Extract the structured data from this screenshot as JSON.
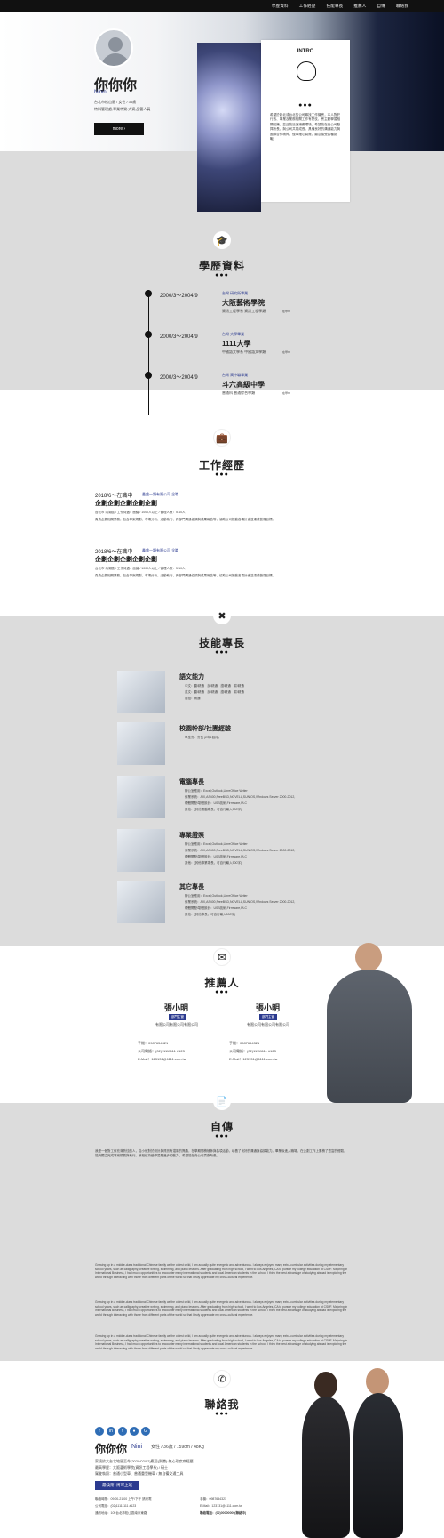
{
  "nav": [
    "學歷資料",
    "工作經歷",
    "技能專長",
    "推薦人",
    "自傳",
    "聯絡我"
  ],
  "profile": {
    "name": "你你你",
    "en": "Ninini",
    "line1": "台北市松山區 / 女性 / 36歲",
    "line2": "特科管理處,專業特質:大資,品管人員",
    "more": "more"
  },
  "intro": {
    "title": "INTRO",
    "body": "希望於新北或台北的公司尋找工作機會，本人對於行政、專業及業務相關工作有熱忱，會主動學習相關知識，並且能迅速適應環境，希望能在貴公司發揮所長，與公司共同成長。具備良好的溝通能力與團隊合作精神，做事細心負責，願意接受各種挑戰。"
  },
  "edu": {
    "title": "學歷資料",
    "items": [
      {
        "date": "2000/3～2004/9",
        "tag": "台灣 研究所畢業",
        "school": "大阪藝術學院",
        "dept": "資訊工程學系 資訊工程學類",
        "note": "在學中"
      },
      {
        "date": "2000/3～2004/9",
        "tag": "台灣 大學畢業",
        "school": "1111大學",
        "dept": "中國語文學系 中國語文學類",
        "note": "在學中"
      },
      {
        "date": "2000/3～2004/9",
        "tag": "台灣 高中職畢業",
        "school": "斗六高級中學",
        "dept": "普通科 普通綜合學類",
        "note": "在學中"
      }
    ]
  },
  "work": {
    "title": "工作經歷",
    "items": [
      {
        "date": "2018/6～在職中",
        "co": "鑫盛一類有限公司 全職",
        "job": "企劃企劃企劃企劃企劃",
        "meta": "台北市 內湖區 / 工作待遇：面議 / 1000人以上 / 管理人數：5-10人",
        "desc": "負責企劃相關業務，包含專案規劃、市場分析、活動執行、跨部門溝通協調與成果報告等，協助公司推動各項計畫並達成營運目標。"
      },
      {
        "date": "2018/6～在職中",
        "co": "鑫盛一類有限公司 全職",
        "job": "企劃企劃企劃企劃企劃",
        "meta": "台北市 內湖區 / 工作待遇：面議 / 1000人以上 / 管理人數：5-10人",
        "desc": "負責企劃相關業務，包含專案規劃、市場分析、活動執行、跨部門溝通協調與成果報告等，協助公司推動各項計畫並達成營運目標。"
      }
    ]
  },
  "skills": {
    "title": "技能專長",
    "items": [
      {
        "name": "語文能力",
        "lines": [
          "中文：聽/精通　說/精通　讀/精通　寫/精通",
          "英文：聽/精通　說/精通　讀/精通　寫/精通",
          "台語：精通"
        ]
      },
      {
        "name": "校園幹部/社團經驗",
        "lines": [
          "學生會：會長 (2年1個月)"
        ]
      },
      {
        "name": "電腦專長",
        "lines": [
          "辦公室應用：Excel,Outlook,LibreOffice Writer",
          "作業系統：AIX,AS400,FreeBSD,NOVELL,SUN OS,Windows Server 2000-2012,",
          "硬體開發/韌體設計：USB技術,Firmware,PLC",
          "其他：(其他電腦專長，可自行輸入500字)"
        ]
      },
      {
        "name": "專業證照",
        "lines": [
          "辦公室應用：Excel,Outlook,LibreOffice Writer",
          "作業系統：AIX,AS400,FreeBSD,NOVELL,SUN OS,Windows Server 2000-2012,",
          "硬體開發/韌體設計：USB技術,Firmware,PLC",
          "其他：(其他專業專長，可自行輸入500字)"
        ]
      },
      {
        "name": "其它專長",
        "lines": [
          "辦公室應用：Excel,Outlook,LibreOffice Writer",
          "作業系統：AIX,AS400,FreeBSD,NOVELL,SUN OS,Windows Server 2000-2012,",
          "硬體開發/韌體設計：USB技術,Firmware,PLC",
          "其他：(其他專長，可自行輸入500字)"
        ]
      }
    ]
  },
  "ref": {
    "title": "推薦人",
    "items": [
      {
        "name": "張小明",
        "tag": "部門主管",
        "co": "有限公司有限公司有限公司",
        "phone": "手機：0987654321",
        "tel": "公司電話：(02)11111111 #123",
        "mail": "E-Mail：123131@1111.com.tw"
      },
      {
        "name": "張小明",
        "tag": "部門主管",
        "co": "有限公司有限公司有限公司",
        "phone": "手機：0987654321",
        "tel": "公司電話：(02)11111111 #123",
        "mail": "E-Mail：123131@1111.com.tw"
      }
    ]
  },
  "bio": {
    "title": "自傳",
    "zh": "我是一個對工作充滿熱忱的人，從小就對於設計與資訊有濃厚的興趣，在學期間積極參與各項活動，培養了良好的溝通與協調能力。畢業後進入職場，在企劃工作上累積了豐富的經驗，能夠獨立完成專案規劃與執行。我相信持續學習是進步的動力，希望能在貴公司貢獻所長。",
    "en1": "Growing up in a middle-class traditional Chinese family as the oldest child, I am actually quite energetic and adventurous. I always enjoyed many extra-curricular activities during my elementary school years, such as calligraphy, creative writing, swimming, and piano lessons. After graduating from high school, I went to Los Angeles, CA to pursue my college education at CSUF. Majoring in International Business, I had much opportunities to encounter many international students and local American students in the school. I think the best advantage of studying abroad is exploring the world through interacting with those from different parts of the world so that I truly appreciate my cross-cultural experience.",
    "en2": "Growing up in a middle-class traditional Chinese family as the oldest child, I am actually quite energetic and adventurous. I always enjoyed many extra-curricular activities during my elementary school years, such as calligraphy, creative writing, swimming, and piano lessons. After graduating from high school, I went to Los Angeles, CA to pursue my college education at CSUF. Majoring in International Business, I had much opportunities to encounter many international students and local American students in the school. I think the best advantage of studying abroad is exploring the world through interacting with those from different parts of the world so that I truly appreciate my cross-cultural experience.",
    "en3": "Growing up in a middle-class traditional Chinese family as the oldest child, I am actually quite energetic and adventurous. I always enjoyed many extra-curricular activities during my elementary school years, such as calligraphy, creative writing, swimming, and piano lessons. After graduating from high school, I went to Los Angeles, CA to pursue my college education at CSUF. Majoring in International Business, I had much opportunities to encounter many international students and local American students in the school. I think the best advantage of studying abroad is exploring the world through interacting with those from different parts of the world so that I truly appreciate my cross-cultural experience."
  },
  "contact": {
    "title": "聯絡我",
    "name": "你你你",
    "en": "Nini",
    "meta": "女性 / 36歲 / 159cm / 48Kg",
    "l1": "家境於大台北地區至今(2020/02/02)應屆(到職)·無心理疾病經歷",
    "l2": "最高學歷：大阪藝術學院(資訊工程學系) / 碩士",
    "l3": "駕駛執照：普通小型車、普通重型機車 / 無自備交通工具",
    "badge": "最快第1周可上班",
    "c1": "聯絡時間：09:00-21:00 上午/下午 請來電",
    "c2": "手機：0987654321",
    "c3": "公司電話：(02)11111111 #123",
    "c4": "E-Mail：123131@1111.com.tw",
    "c5": "通訊地址：105台北市松山區南京東路",
    "c6": "聯絡電話：(02)00000000(聯絡中)"
  }
}
